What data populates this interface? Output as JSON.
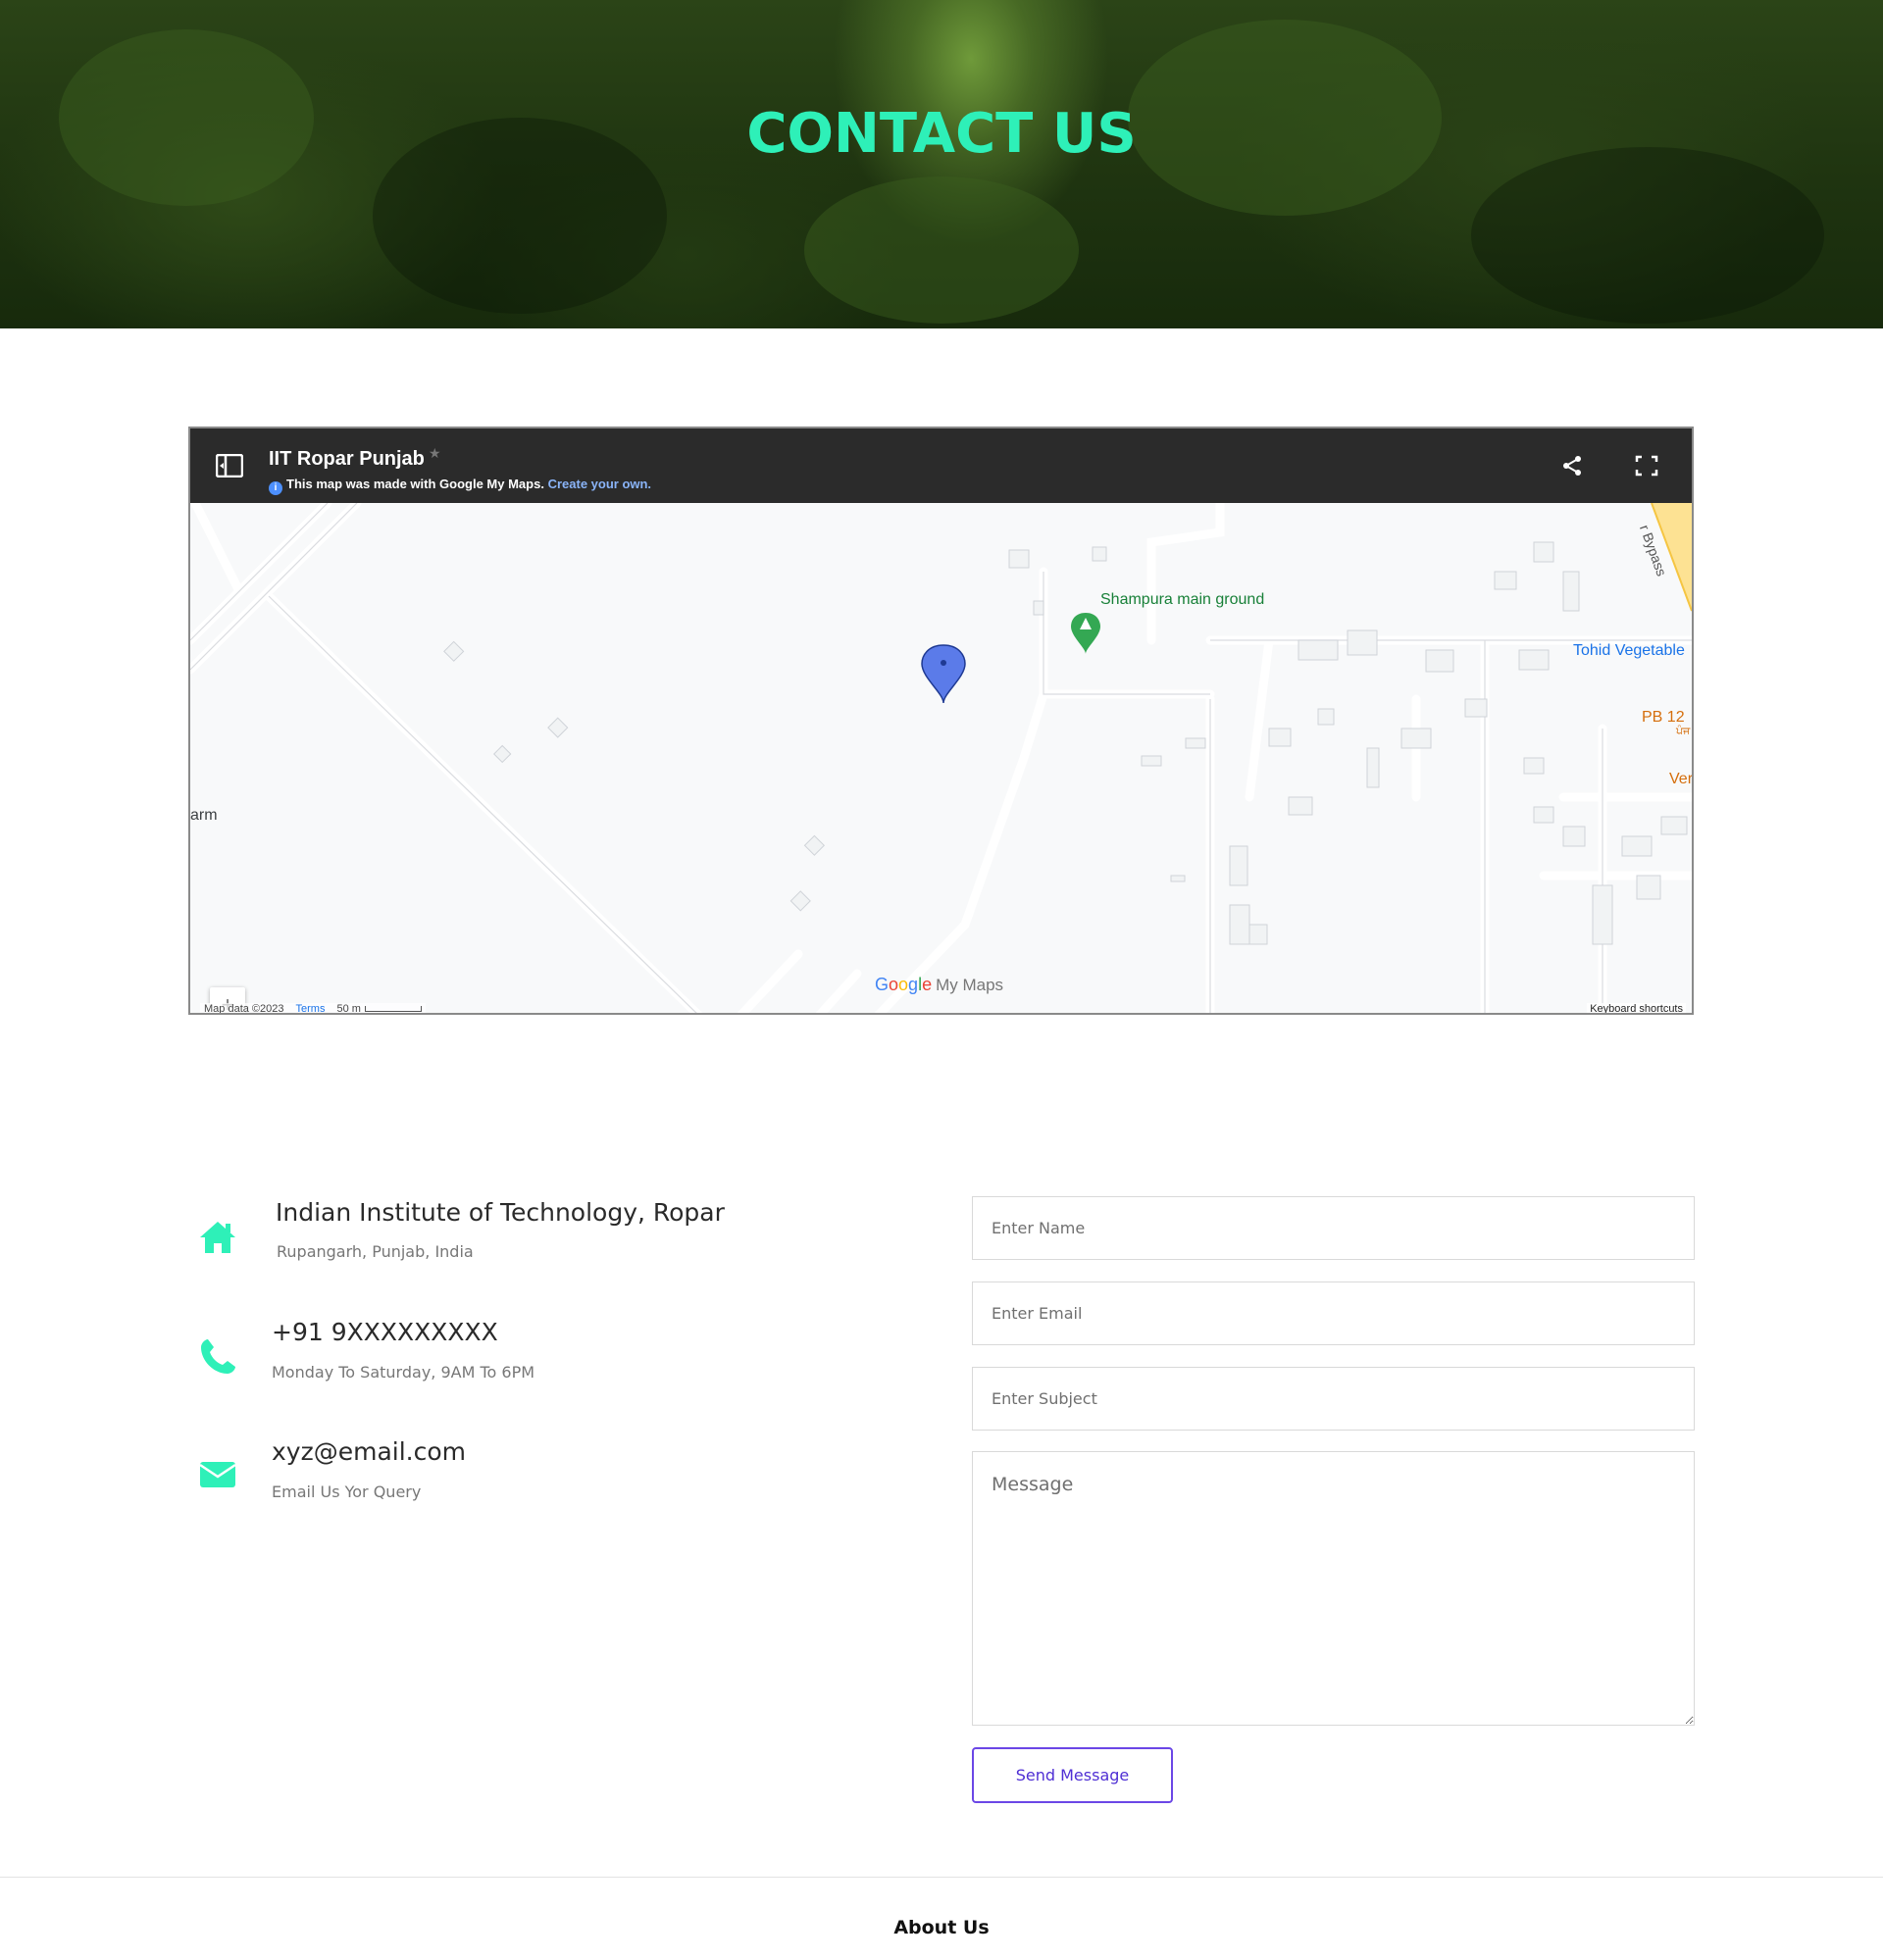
{
  "hero": {
    "title": "CONTACT US"
  },
  "map": {
    "title": "IIT Ropar Punjab",
    "subtitle": "This map was made with Google My Maps.",
    "create_link": "Create your own.",
    "labels": {
      "place1": "Shampura main ground",
      "place2": "Tohid Vegetable",
      "place3": "PB 12",
      "place3_sub": "ਪੰਜ",
      "place4": "Ver",
      "place5": "arm",
      "road": "r Bypass"
    },
    "brand_google": "Google",
    "brand_mymaps": "My Maps",
    "map_data": "Map data ©2023",
    "terms": "Terms",
    "scale": "50 m",
    "keyboard_shortcuts": "Keyboard shortcuts",
    "zoom_in": "+",
    "zoom_out": "−",
    "icons": [
      "sidebar-toggle-icon",
      "star-icon",
      "info-icon",
      "share-icon",
      "fullscreen-icon",
      "map-pin-icon",
      "tree-marker-icon"
    ]
  },
  "contact": {
    "address": {
      "icon": "home-icon",
      "title": "Indian Institute of Technology, Ropar",
      "subtitle": "Rupangarh, Punjab, India"
    },
    "phone": {
      "icon": "phone-icon",
      "title": "+91 9XXXXXXXXX",
      "subtitle": "Monday To Saturday, 9AM To 6PM"
    },
    "email": {
      "icon": "envelope-icon",
      "title": "xyz@email.com",
      "subtitle": "Email Us Yor Query"
    }
  },
  "form": {
    "name_placeholder": "Enter Name",
    "email_placeholder": "Enter Email",
    "subject_placeholder": "Enter Subject",
    "message_placeholder": "Message",
    "send_label": "Send Message"
  },
  "footer": {
    "heading": "About Us"
  },
  "colors": {
    "accent": "#2ef0b8",
    "button_border": "#6b47e6",
    "map_header": "#2b2b2b"
  }
}
